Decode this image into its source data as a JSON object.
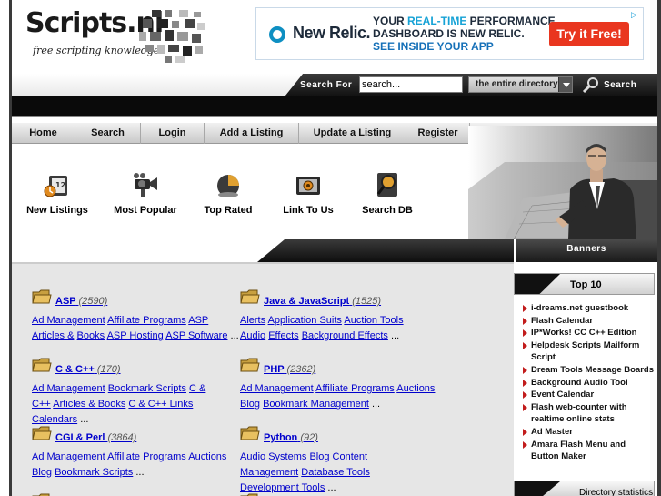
{
  "brand": {
    "name": "Scripts.nl",
    "tagline": "free scripting knowledge"
  },
  "ad": {
    "brand": "New Relic.",
    "line1_pre": "YOUR ",
    "line1_accent": "REAL-TIME",
    "line1_post": " PERFORMANCE",
    "line2": "DASHBOARD IS NEW RELIC.",
    "line3": "SEE INSIDE YOUR APP",
    "cta": "Try it Free!",
    "choices_glyph": "▷"
  },
  "search": {
    "label": "Search For",
    "input_value": "search...",
    "scope_selected": "the entire directory",
    "button_label": "Search"
  },
  "nav": {
    "items": [
      {
        "label": "Home"
      },
      {
        "label": "Search"
      },
      {
        "label": "Login"
      },
      {
        "label": "Add a Listing"
      },
      {
        "label": "Update a Listing"
      },
      {
        "label": "Register"
      }
    ]
  },
  "shortcuts": {
    "items": [
      {
        "label": "New Listings",
        "icon": "new-listings-icon"
      },
      {
        "label": "Most Popular",
        "icon": "camera-icon"
      },
      {
        "label": "Top Rated",
        "icon": "pie-chart-icon"
      },
      {
        "label": "Link To Us",
        "icon": "link-to-us-icon"
      },
      {
        "label": "Search DB",
        "icon": "magnifier-icon"
      }
    ]
  },
  "banners": {
    "label": "Banners"
  },
  "categories": [
    {
      "name": "ASP",
      "count": "(2590)",
      "links": [
        "Ad Management",
        "Affiliate Programs",
        "ASP Articles &",
        "Books",
        "ASP Hosting",
        "ASP Software"
      ]
    },
    {
      "name": "Java & JavaScript",
      "count": "(1525)",
      "links": [
        "Alerts",
        "Application Suits",
        "Auction Tools",
        "Audio",
        "Effects",
        "Background Effects"
      ]
    },
    {
      "name": "C & C++",
      "count": "(170)",
      "links": [
        "Ad Management",
        "Bookmark Scripts",
        "C & C++",
        "Articles & Books",
        "C & C++ Links",
        "Calendars"
      ]
    },
    {
      "name": "PHP",
      "count": "(2362)",
      "links": [
        "Ad Management",
        "Affiliate Programs",
        "Auctions",
        "Blog",
        "Bookmark Management"
      ]
    },
    {
      "name": "CGI & Perl",
      "count": "(3864)",
      "links": [
        "Ad Management",
        "Affiliate Programs",
        "Auctions",
        "Blog",
        "Bookmark Scripts"
      ]
    },
    {
      "name": "Python",
      "count": "(92)",
      "links": [
        "Audio Systems",
        "Blog",
        "Content Management",
        "Database Tools",
        "Development Tools"
      ]
    }
  ],
  "more_marker": "...",
  "top10": {
    "title": "Top 10",
    "items": [
      "i-dreams.net guestbook",
      "Flash Calendar",
      "IP*Works! CC C++ Edition",
      "Helpdesk Scripts Mailform Script",
      "Dream Tools Message Boards",
      "Background Audio Tool",
      "Event Calendar",
      "Flash web-counter with realtime online stats",
      "Ad Master",
      "Amara Flash Menu and Button Maker"
    ]
  },
  "dir_stats": {
    "title": "Directory statistics"
  },
  "colors": {
    "link": "#0000cc",
    "bullet": "#c21c1c",
    "ad_button": "#e9361f",
    "ad_accent": "#15a2d6"
  }
}
